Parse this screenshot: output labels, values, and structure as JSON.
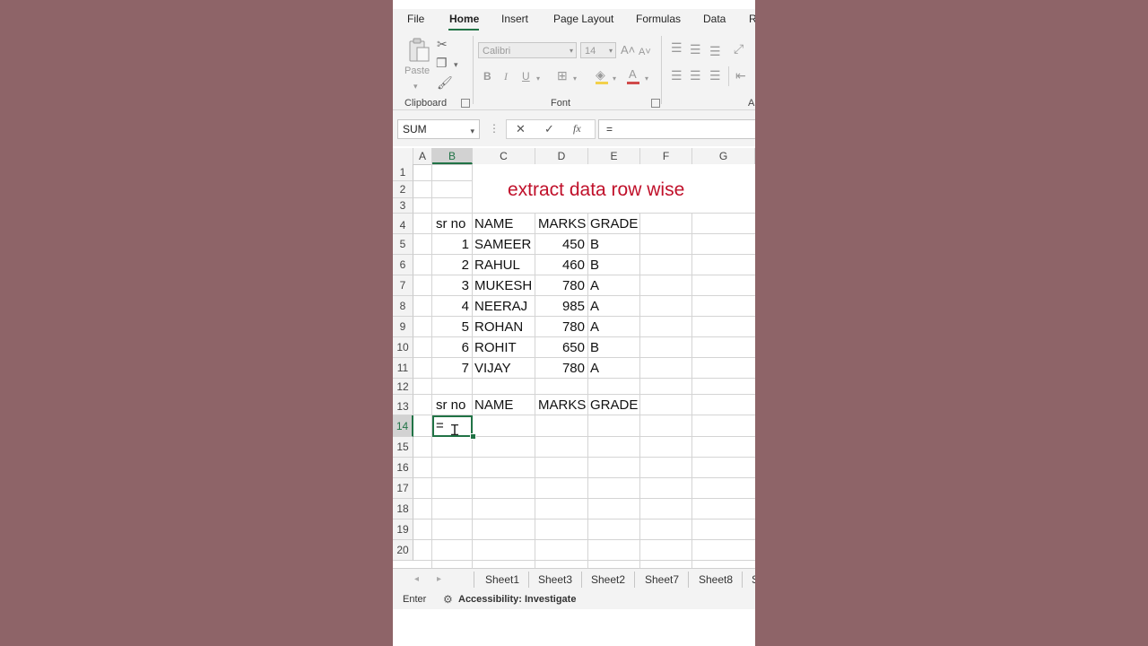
{
  "ribbon": {
    "tabs": [
      "File",
      "Home",
      "Insert",
      "Page Layout",
      "Formulas",
      "Data",
      "R"
    ],
    "active_tab": "Home",
    "clipboard_label": "Clipboard",
    "font_label": "Font",
    "alignment_label_partial": "A",
    "paste_label": "Paste",
    "font_name": "Calibri",
    "font_size": "14",
    "bold": "B",
    "italic": "I",
    "underline": "U"
  },
  "formula_bar": {
    "name_box": "SUM",
    "cancel": "✕",
    "enter": "✓",
    "fx": "fx",
    "formula": "="
  },
  "grid": {
    "columns": [
      "A",
      "B",
      "C",
      "D",
      "E",
      "F",
      "G"
    ],
    "selected_column": "B",
    "rows": [
      "1",
      "2",
      "3",
      "4",
      "5",
      "6",
      "7",
      "8",
      "9",
      "10",
      "11",
      "12",
      "13",
      "14",
      "15",
      "16",
      "17",
      "18",
      "19",
      "20"
    ],
    "selected_row": "14",
    "title": "extract data row wise",
    "headers": [
      "sr no",
      "NAME",
      "MARKS",
      "GRADE"
    ],
    "records": [
      {
        "sr": "1",
        "name": "SAMEER",
        "marks": "450",
        "grade": "B"
      },
      {
        "sr": "2",
        "name": "RAHUL",
        "marks": "460",
        "grade": "B"
      },
      {
        "sr": "3",
        "name": "MUKESH",
        "marks": "780",
        "grade": "A"
      },
      {
        "sr": "4",
        "name": "NEERAJ",
        "marks": "985",
        "grade": "A"
      },
      {
        "sr": "5",
        "name": "ROHAN",
        "marks": "780",
        "grade": "A"
      },
      {
        "sr": "6",
        "name": "ROHIT",
        "marks": "650",
        "grade": "B"
      },
      {
        "sr": "7",
        "name": "VIJAY",
        "marks": "780",
        "grade": "A"
      }
    ],
    "headers2": [
      "sr no",
      "NAME",
      "MARKS",
      "GRADE"
    ],
    "active_cell_value": "="
  },
  "sheets": [
    "Sheet1",
    "Sheet3",
    "Sheet2",
    "Sheet7",
    "Sheet8",
    "S"
  ],
  "status": {
    "mode": "Enter",
    "accessibility": "Accessibility: Investigate"
  },
  "colors": {
    "background": "#8e6468",
    "accent": "#217346",
    "title": "#c0102a"
  }
}
